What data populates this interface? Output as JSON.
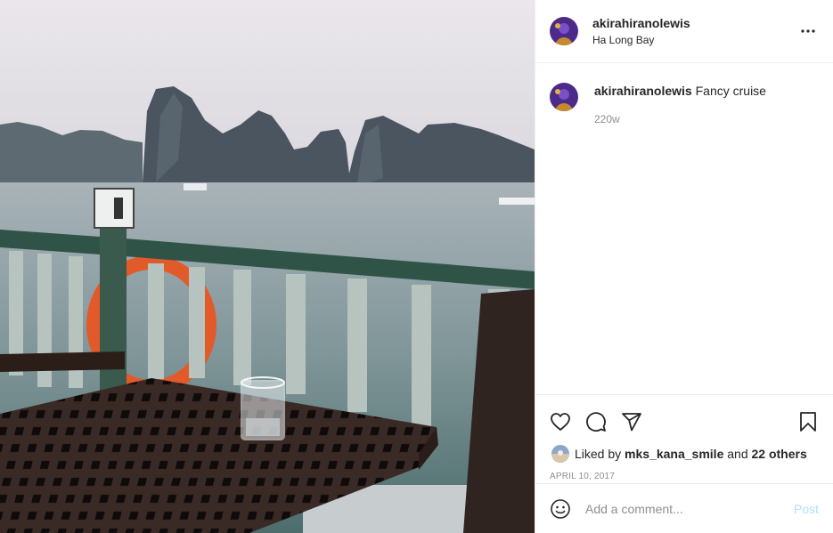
{
  "post": {
    "photo_alt": "Fancy cruise",
    "header": {
      "username": "akirahiranolewis",
      "location": "Ha Long Bay"
    },
    "caption": {
      "username": "akirahiranolewis",
      "text": "Fancy cruise",
      "time": "220w"
    },
    "likes": {
      "prefix": "Liked by",
      "user": "mks_kana_smile",
      "joiner": "and",
      "others": "22 others"
    },
    "date": "APRIL 10, 2017",
    "comment_box": {
      "placeholder": "Add a comment...",
      "post_label": "Post"
    },
    "icons": {
      "more": "more-options-icon",
      "like": "heart-icon",
      "comment": "comment-icon",
      "share": "share-icon",
      "save": "bookmark-icon",
      "emoji": "emoji-icon"
    }
  }
}
